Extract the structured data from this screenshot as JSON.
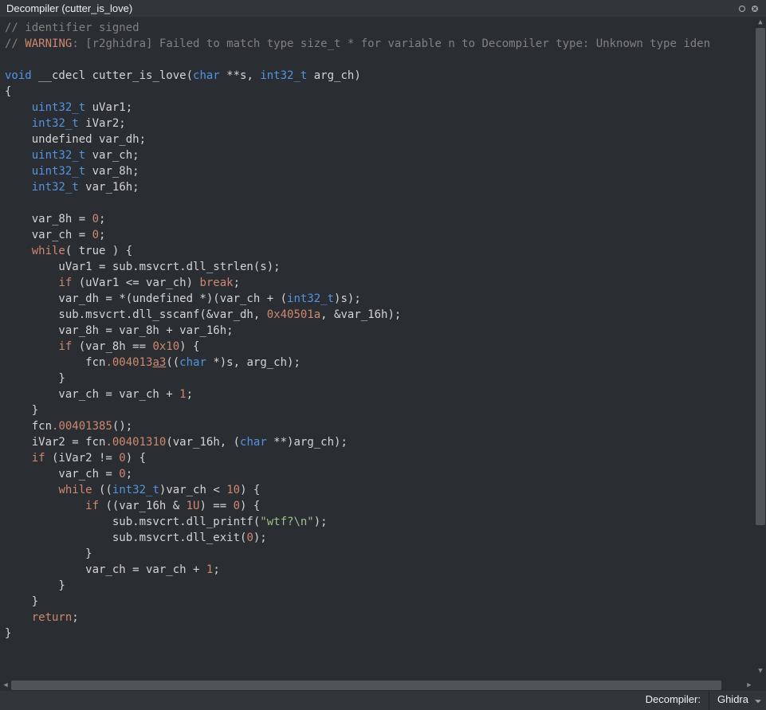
{
  "titlebar": {
    "title": "Decompiler (cutter_is_love)"
  },
  "code": {
    "comment_identifier": "// identifier signed",
    "comment_slash": "//",
    "warning_prefix": " ",
    "warning_label": "WARNING",
    "warning_msg": ": [r2ghidra] Failed to match type size_t * for variable n to Decompiler type: Unknown type iden",
    "fn_void": "void",
    "fn_cdecl": " __cdecl cutter_is_love(",
    "fn_char": "char",
    "fn_s": " **s, ",
    "fn_int32": "int32_t",
    "fn_argch": " arg_ch)",
    "brace_open": "{",
    "decl1_type": "uint32_t",
    "decl1_name": " uVar1;",
    "decl2_type": "int32_t",
    "decl2_name": " iVar2;",
    "decl3": "    undefined var_dh;",
    "decl4_type": "uint32_t",
    "decl4_name": " var_ch;",
    "decl5_type": "uint32_t",
    "decl5_name": " var_8h;",
    "decl6_type": "int32_t",
    "decl6_name_a": " var_",
    "decl6_name_b": "6h;",
    "assign1_a": "    var_8h = ",
    "assign1_b": "0",
    "assign1_c": ";",
    "assign2_a": "    var_ch = ",
    "assign2_b": "0",
    "assign2_c": ";",
    "while1_kw": "while",
    "while1_body": "( true ) {",
    "uvar1_line": "        uVar1 = sub.msvcrt.dll_strlen(s);",
    "if1_kw": "if",
    "if1_cond": " (uVar1 <= var_ch) ",
    "break_kw": "break",
    "semicolon": ";",
    "vardh_a": "        var_dh = *(undefined *)(var_ch + (",
    "vardh_type": "int32_t",
    "vardh_b": ")s);",
    "sscanf_a": "        sub.msvcrt.dll_sscanf(&var_dh, ",
    "sscanf_hex": "0x40501a",
    "sscanf_b": ", &var_16h);",
    "var8h_line": "        var_8h = var_8h + var_16h;",
    "if2_kw": "if",
    "if2_a": " (var_8h == ",
    "if2_hex": "0x10",
    "if2_b": ") {",
    "fcn1_a": "            fcn",
    "fcn1_dot": ".",
    "fcn1_addr_a": "004013",
    "fcn1_addr_b": "a3",
    "fcn1_paren": "((",
    "fcn1_char": "char",
    "fcn1_b": " *)s, arg_ch);",
    "brace_close_8": "        }",
    "varch_inc_a": "        var_ch = var_ch + ",
    "varch_inc_b": "1",
    "varch_inc_c": ";",
    "brace_close_4": "    }",
    "fcn2_a": "    fcn",
    "fcn2_dot": ".",
    "fcn2_addr": "00401385",
    "fcn2_b": "();",
    "ivar2_a": "    iVar2 = fcn",
    "ivar2_dot": ".",
    "ivar2_addr": "00401310",
    "ivar2_paren": "(var_16h, (",
    "ivar2_char": "char",
    "ivar2_b": " **)arg_ch);",
    "if3_kw": "if",
    "if3_a": " (iVar2 != ",
    "if3_zero": "0",
    "if3_b": ") {",
    "varch0_a": "        var_ch = ",
    "varch0_b": "0",
    "varch0_c": ";",
    "while2_kw": "while",
    "while2_a": " ((",
    "while2_type": "int32_t",
    "while2_b": ")var_ch < ",
    "while2_ten": "10",
    "while2_c": ") {",
    "if4_kw": "if",
    "if4_a": " ((var_16h & ",
    "if4_one": "1U",
    "if4_b": ") == ",
    "if4_zero": "0",
    "if4_c": ") {",
    "printf_a": "                sub.msvcrt.dll_printf(",
    "printf_str": "\"wtf?\\n\"",
    "printf_b": ");",
    "exit_a": "                sub.msvcrt.dll_exit(",
    "exit_zero": "0",
    "exit_b": ");",
    "brace_close_12": "            }",
    "varch_inc2_a": "            var_ch = var_ch + ",
    "varch_inc2_b": "1",
    "varch_inc2_c": ";",
    "return_kw": "return",
    "return_semi": ";",
    "brace_close_0": "}"
  },
  "statusbar": {
    "label": "Decompiler:",
    "value": "Ghidra"
  }
}
